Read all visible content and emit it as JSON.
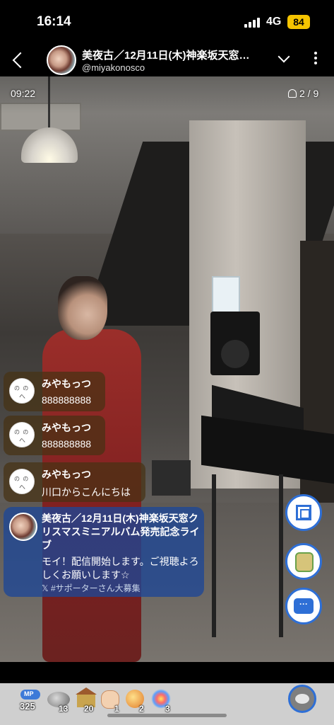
{
  "status_bar": {
    "time": "16:14",
    "network": "4G",
    "battery": "84"
  },
  "header": {
    "title": "美夜古／12月11日(木)神楽坂天窓…",
    "handle": "@miyakonosco"
  },
  "stream": {
    "elapsed": "09:22",
    "viewers": "2 / 9"
  },
  "comments": [
    {
      "name": "みやもっつ",
      "text": "888888888"
    },
    {
      "name": "みやもっつ",
      "text": "888888888"
    },
    {
      "name": "みやもっつ",
      "text": "川口からこんにちは"
    }
  ],
  "notice": {
    "title": "美夜古／12月11日(木)神楽坂天窓クリスマスミニアルバム発売記念ライブ",
    "body": "モイ！配信開始します。ご視聴よろしくお願いします☆",
    "tag": "𝕏 #サポーターさん大募集"
  },
  "gifts": [
    {
      "name": "mp",
      "label": "MP",
      "count": "325"
    },
    {
      "name": "coin",
      "count": "13"
    },
    {
      "name": "house",
      "count": "20"
    },
    {
      "name": "hands",
      "count": "1"
    },
    {
      "name": "ball",
      "count": "2"
    },
    {
      "name": "firework",
      "count": "3"
    }
  ],
  "colors": {
    "accent": "#2e6fd6",
    "battery": "#f5c400",
    "comment_bg": "#46321499",
    "notice_bg": "#1e4696"
  },
  "icons": [
    "back-icon",
    "chevron-down-icon",
    "more-icon",
    "person-icon",
    "screenshot-icon",
    "gift-bag-icon",
    "comment-icon",
    "gift-menu-icon"
  ]
}
